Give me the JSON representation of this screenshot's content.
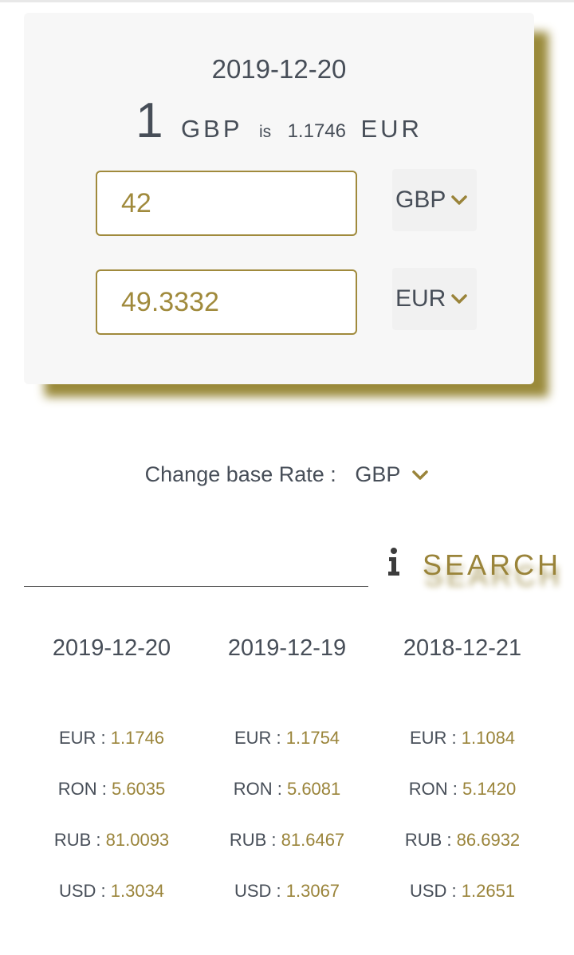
{
  "converter": {
    "date": "2019-12-20",
    "rate_amount": "1",
    "base_code": "GBP",
    "is_label": "is",
    "rate_value": "1.1746",
    "target_code": "EUR",
    "from_amount": "42",
    "from_currency": "GBP",
    "to_amount": "49.3332",
    "to_currency": "EUR"
  },
  "base_rate": {
    "label": "Change base Rate :",
    "selected": "GBP"
  },
  "search": {
    "value": "",
    "info_icon": "info-icon",
    "button_label": "SEARCH"
  },
  "history": [
    {
      "date": "2019-12-20",
      "rates": [
        {
          "code": "EUR :",
          "value": "1.1746"
        },
        {
          "code": "RON :",
          "value": "5.6035"
        },
        {
          "code": "RUB :",
          "value": "81.0093"
        },
        {
          "code": "USD :",
          "value": "1.3034"
        }
      ]
    },
    {
      "date": "2019-12-19",
      "rates": [
        {
          "code": "EUR :",
          "value": "1.1754"
        },
        {
          "code": "RON :",
          "value": "5.6081"
        },
        {
          "code": "RUB :",
          "value": "81.6467"
        },
        {
          "code": "USD :",
          "value": "1.3067"
        }
      ]
    },
    {
      "date": "2018-12-21",
      "rates": [
        {
          "code": "EUR :",
          "value": "1.1084"
        },
        {
          "code": "RON :",
          "value": "5.1420"
        },
        {
          "code": "RUB :",
          "value": "86.6932"
        },
        {
          "code": "USD :",
          "value": "1.2651"
        }
      ]
    }
  ],
  "colors": {
    "accent": "#9a843a",
    "text": "#474e58",
    "card_background": "#f7f7f7"
  }
}
